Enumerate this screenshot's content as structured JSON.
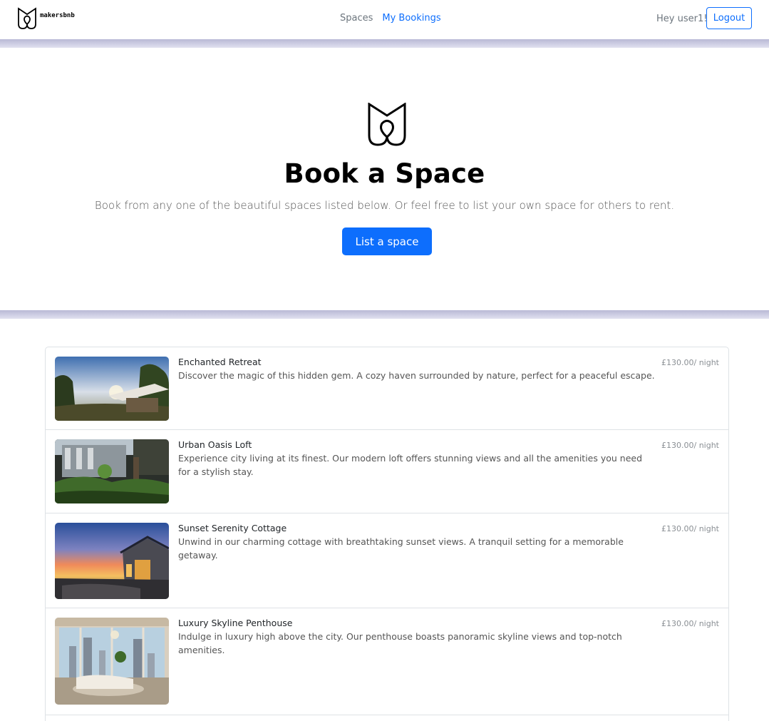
{
  "brand": {
    "name": "makersbnb"
  },
  "nav": {
    "links": [
      {
        "label": "Spaces",
        "active": false
      },
      {
        "label": "My Bookings",
        "active": true
      }
    ],
    "greeting": "Hey user1!",
    "logout_label": "Logout"
  },
  "hero": {
    "title": "Book a Space",
    "subtitle": "Book from any one of the beautiful spaces listed below. Or feel free to list your own space for others to rent.",
    "button_label": "List a space"
  },
  "spaces": [
    {
      "title": "Enchanted Retreat",
      "description": "Discover the magic of this hidden gem. A cozy haven surrounded by nature, perfect for a peaceful escape.",
      "price": "£130.00/ night"
    },
    {
      "title": "Urban Oasis Loft",
      "description": "Experience city living at its finest. Our modern loft offers stunning views and all the amenities you need for a stylish stay.",
      "price": "£130.00/ night"
    },
    {
      "title": "Sunset Serenity Cottage",
      "description": "Unwind in our charming cottage with breathtaking sunset views. A tranquil setting for a memorable getaway.",
      "price": "£130.00/ night"
    },
    {
      "title": "Luxury Skyline Penthouse",
      "description": "Indulge in luxury high above the city. Our penthouse boasts panoramic skyline views and top-notch amenities.",
      "price": "£130.00/ night"
    }
  ],
  "colors": {
    "primary": "#0d6efd",
    "band": "#cfcfe6"
  }
}
